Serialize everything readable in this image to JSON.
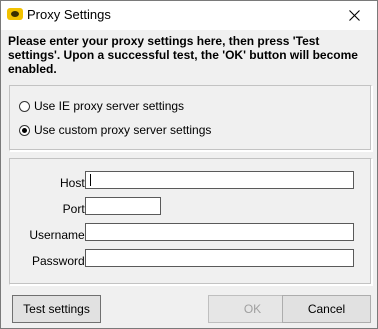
{
  "window": {
    "title": "Proxy Settings",
    "app_icon": "proxy-app-icon",
    "close_glyph": "✕"
  },
  "instructions": "Please enter your proxy settings here, then press 'Test settings'.  Upon a successful test, the 'OK' button will become enabled.",
  "proxy_mode": {
    "options": [
      {
        "label": "Use IE proxy server settings",
        "checked": false
      },
      {
        "label": "Use custom proxy server settings",
        "checked": true
      }
    ]
  },
  "fields": {
    "host": {
      "label": "Host:",
      "value": ""
    },
    "port": {
      "label": "Port:",
      "value": ""
    },
    "username": {
      "label": "Username:",
      "value": ""
    },
    "password": {
      "label": "Password:",
      "value": ""
    }
  },
  "buttons": {
    "test": "Test settings",
    "ok": "OK",
    "cancel": "Cancel"
  }
}
